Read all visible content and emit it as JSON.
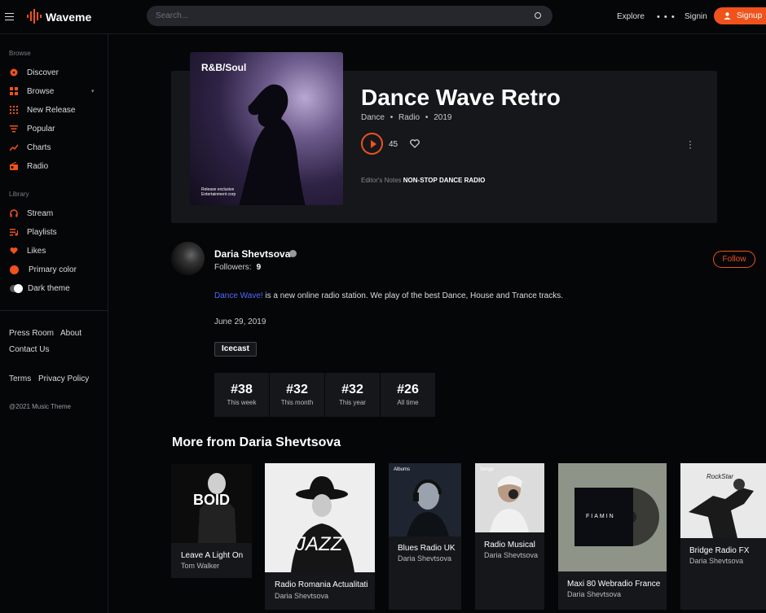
{
  "app": {
    "brand": "Waveme"
  },
  "header": {
    "search_placeholder": "Search...",
    "explore": "Explore",
    "more": "• • •",
    "signin": "Signin",
    "signup": "Signup",
    "accent": "#f0521c"
  },
  "sidebar": {
    "browse_heading": "Browse",
    "items": [
      {
        "label": "Discover",
        "icon": "disc-icon"
      },
      {
        "label": "Browse",
        "icon": "grid-icon"
      },
      {
        "label": "New Release",
        "icon": "new-release-icon"
      },
      {
        "label": "Popular",
        "icon": "popular-icon"
      },
      {
        "label": "Charts",
        "icon": "chart-icon"
      },
      {
        "label": "Radio",
        "icon": "radio-icon"
      }
    ],
    "library_heading": "Library",
    "library": [
      {
        "label": "Stream",
        "icon": "headphones-icon"
      },
      {
        "label": "Playlists",
        "icon": "playlist-icon"
      },
      {
        "label": "Likes",
        "icon": "heart-icon"
      },
      {
        "label": "Primary color",
        "icon": "color-dot-icon"
      },
      {
        "label": "Dark theme",
        "icon": "toggle-icon"
      }
    ],
    "footer": {
      "press": "Press Room",
      "about": "About",
      "contact": "Contact Us",
      "terms": "Terms",
      "privacy": "Privacy Policy",
      "copyright": "@2021 Music Theme"
    }
  },
  "station": {
    "cover_label": "R&B/Soul",
    "cover_small_1": "Release exclusive",
    "cover_small_2": "Entertainment corp",
    "title": "Dance Wave Retro",
    "genre": "Dance",
    "type": "Radio",
    "year": "2019",
    "sep": "•",
    "plays": "45",
    "notes_label": "Editor's Notes",
    "notes_value": "NON-STOP DANCE RADIO"
  },
  "artist": {
    "name": "Daria Shevtsova",
    "followers_label": "Followers:",
    "followers": "9",
    "follow": "Follow",
    "desc_link": "Dance Wave!",
    "desc_rest": " is a new online radio station. We play of the best Dance, House and Trance tracks.",
    "date": "June 29, 2019",
    "tag": "Icecast"
  },
  "stats": [
    {
      "rank": "#38",
      "label": "This week"
    },
    {
      "rank": "#32",
      "label": "This month"
    },
    {
      "rank": "#32",
      "label": "This year"
    },
    {
      "rank": "#26",
      "label": "All time"
    }
  ],
  "more": {
    "title": "More from Daria Shevtsova",
    "cards": [
      {
        "title": "Leave A Light On",
        "artist": "Tom Walker"
      },
      {
        "title": "Radio Romania Actualitati",
        "artist": "Daria Shevtsova"
      },
      {
        "title": "Blues Radio UK",
        "artist": "Daria Shevtsova"
      },
      {
        "title": "Radio Musical",
        "artist": "Daria Shevtsova"
      },
      {
        "title": "Maxi 80 Webradio France",
        "artist": "Daria Shevtsova"
      },
      {
        "title": "Bridge Radio FX",
        "artist": "Daria Shevtsova"
      }
    ],
    "art_text": {
      "boid": "BOID",
      "jazz": "JAZZ",
      "albums": "Albums",
      "songs": "Songs",
      "fiamin": "FIAMIN",
      "rockstar": "RockStar"
    }
  }
}
